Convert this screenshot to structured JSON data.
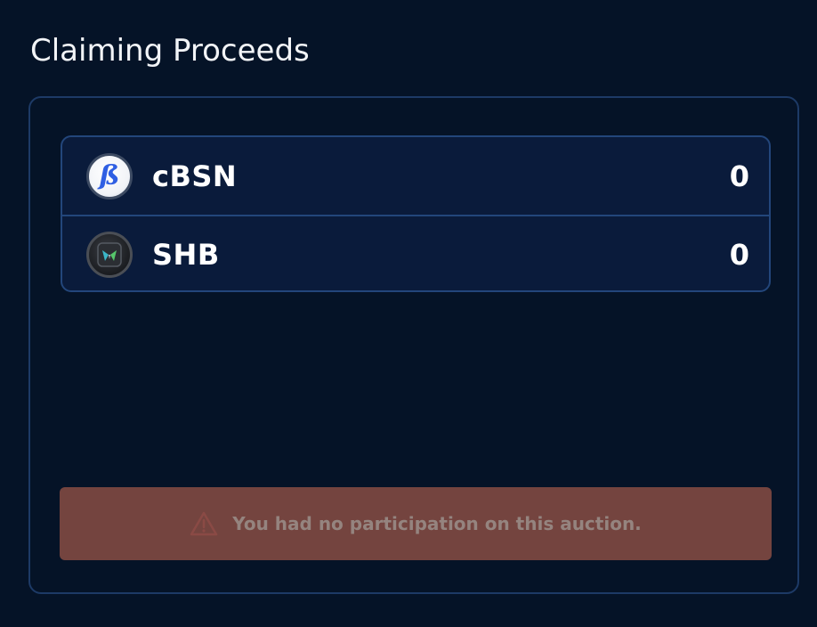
{
  "page": {
    "title": "Claiming Proceeds"
  },
  "tokens": [
    {
      "symbol": "cBSN",
      "amount": "0",
      "icon": "cbsn-logo-icon",
      "icon_glyph": "ß"
    },
    {
      "symbol": "SHB",
      "amount": "0",
      "icon": "shb-logo-icon"
    }
  ],
  "alert": {
    "icon": "warning-triangle-icon",
    "message": "You had no participation on this auction."
  },
  "colors": {
    "background": "#051327",
    "panel_border": "#1d3a66",
    "list_background": "#0a1b3b",
    "list_border": "#23467b",
    "alert_background": "#74443f",
    "alert_text": "#95847f",
    "warning_icon": "#8a4a45",
    "cbsn_glyph": "#2f5fe3"
  }
}
